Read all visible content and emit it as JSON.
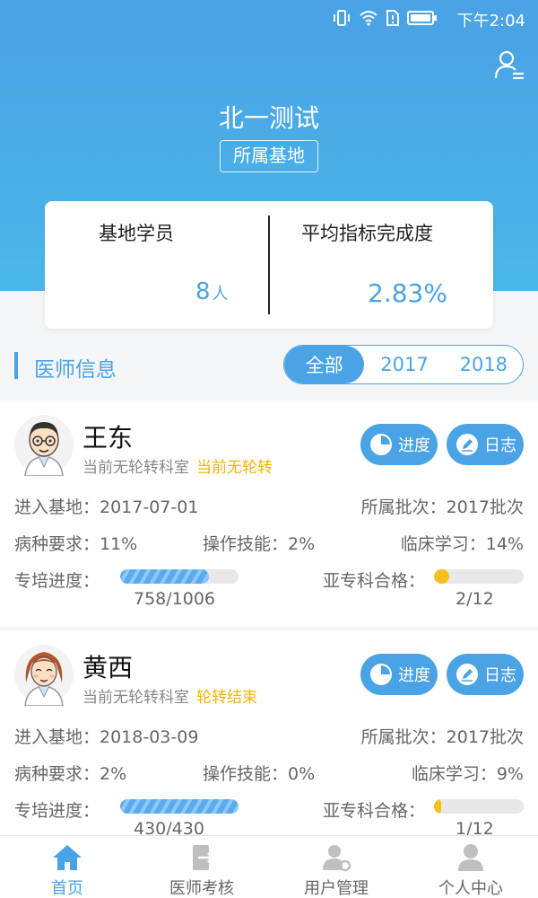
{
  "status_bar": {
    "time": "下午2:04"
  },
  "header": {
    "title": "北一测试",
    "base_tag": "所属基地"
  },
  "stats": {
    "students_label": "基地学员",
    "students_value": "8",
    "students_unit": "人",
    "avg_label": "平均指标完成度",
    "avg_value": "2.83%"
  },
  "section": {
    "title": "医师信息",
    "year_tabs": [
      "全部",
      "2017",
      "2018"
    ],
    "active_tab": 0
  },
  "cards": [
    {
      "name": "王东",
      "dept": "当前无轮转科室",
      "rotation": "当前无轮转",
      "progress_btn": "进度",
      "log_btn": "日志",
      "enter_base": "进入基地：2017-07-01",
      "batch": "所属批次：2017批次",
      "disease_req": "病种要求：11%",
      "operation": "操作技能：2%",
      "clinical": "临床学习：14%",
      "training_label": "专培进度：",
      "training_fraction": "758/1006",
      "training_ratio": 0.7535,
      "subspec_label": "亚专科合格：",
      "subspec_fraction": "2/12",
      "subspec_ratio": 0.167
    },
    {
      "name": "黄西",
      "dept": "当前无轮转科室",
      "rotation": "轮转结束",
      "progress_btn": "进度",
      "log_btn": "日志",
      "enter_base": "进入基地：2018-03-09",
      "batch": "所属批次：2017批次",
      "disease_req": "病种要求：2%",
      "operation": "操作技能：0%",
      "clinical": "临床学习：9%",
      "training_label": "专培进度：",
      "training_fraction": "430/430",
      "training_ratio": 1.0,
      "subspec_label": "亚专科合格：",
      "subspec_fraction": "1/12",
      "subspec_ratio": 0.083
    }
  ],
  "tabbar": {
    "items": [
      "首页",
      "医师考核",
      "用户管理",
      "个人中心"
    ],
    "active": 0
  },
  "colors": {
    "primary": "#4aa3e4",
    "accent": "#f5b400",
    "text_dark": "#111111",
    "text_muted": "#666666"
  }
}
